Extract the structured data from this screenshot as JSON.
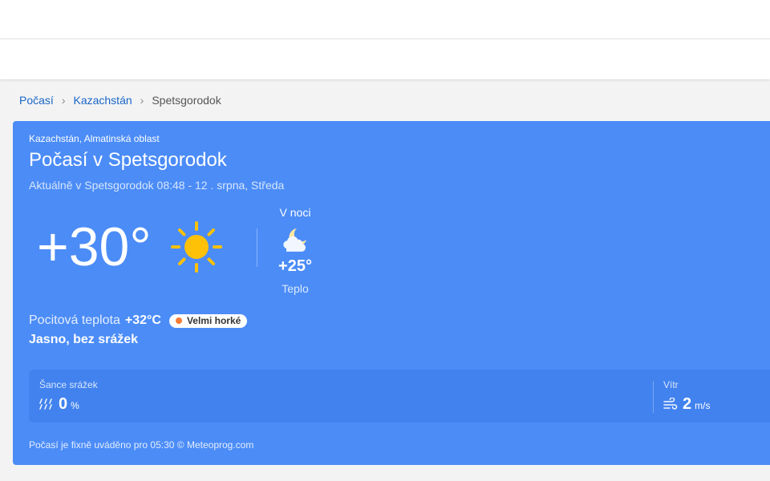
{
  "breadcrumb": {
    "items": [
      {
        "label": "Počasí"
      },
      {
        "label": "Kazachstán"
      },
      {
        "label": "Spetsgorodok"
      }
    ],
    "separator": "›"
  },
  "card": {
    "region": "Kazachstán, Almatinská oblast",
    "title": "Počasí v Spetsgorodok",
    "updated": "Aktuálně v Spetsgorodok 08:48 - 12 . srpna, Středa",
    "current_temp": "+30°",
    "current_icon": "sun-icon",
    "night": {
      "label": "V noci",
      "icon": "moon-cloud-icon",
      "temp": "+25°",
      "desc": "Teplo"
    },
    "feels_like": {
      "label": "Pocitová teplota",
      "value": "+32°C",
      "badge": "Velmi horké",
      "badge_color": "#f57c35"
    },
    "condition": "Jasno, bez srážek",
    "precipitation": {
      "label": "Šance srážek",
      "value": "0",
      "unit": "%",
      "icon": "rain-icon"
    },
    "wind": {
      "label": "Vítr",
      "value": "2",
      "unit": "m/s",
      "icon": "wind-icon"
    },
    "footer": "Počasí je fixně uváděno pro 05:30 © Meteoprog.com"
  },
  "colors": {
    "card_bg": "#4b8cf7",
    "stats_bg": "#4182ee",
    "link": "#1a66c9",
    "sun": "#ffc107"
  }
}
